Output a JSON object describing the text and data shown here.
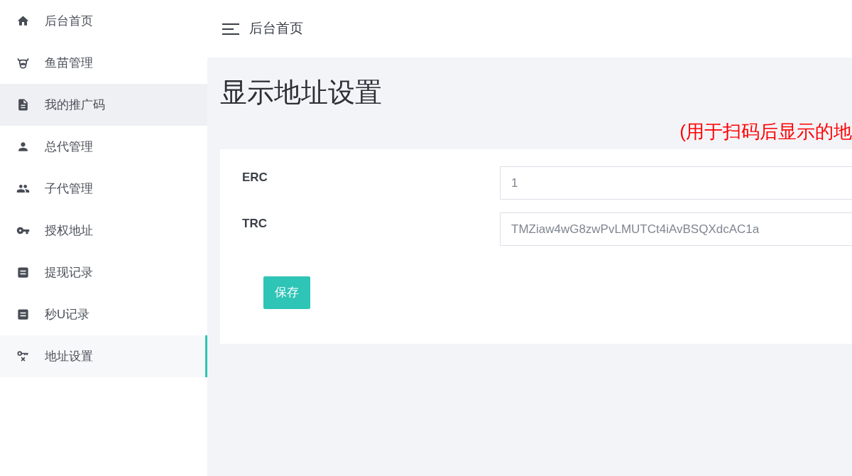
{
  "sidebar": {
    "items": [
      {
        "label": "后台首页",
        "selected": false,
        "hovered": false
      },
      {
        "label": "鱼苗管理",
        "selected": false,
        "hovered": false
      },
      {
        "label": "我的推广码",
        "selected": false,
        "hovered": true
      },
      {
        "label": "总代管理",
        "selected": false,
        "hovered": false
      },
      {
        "label": "子代管理",
        "selected": false,
        "hovered": false
      },
      {
        "label": "授权地址",
        "selected": false,
        "hovered": false
      },
      {
        "label": "提现记录",
        "selected": false,
        "hovered": false
      },
      {
        "label": "秒U记录",
        "selected": false,
        "hovered": false
      },
      {
        "label": "地址设置",
        "selected": true,
        "hovered": false
      }
    ]
  },
  "header": {
    "breadcrumb": "后台首页"
  },
  "page": {
    "title": "显示地址设置",
    "note": "(用于扫码后显示的地"
  },
  "form": {
    "fields": [
      {
        "label": "ERC",
        "value": "1"
      },
      {
        "label": "TRC",
        "value": "TMZiaw4wG8zwPvLMUTCt4iAvBSQXdcAC1a"
      }
    ],
    "submit": "保存"
  }
}
